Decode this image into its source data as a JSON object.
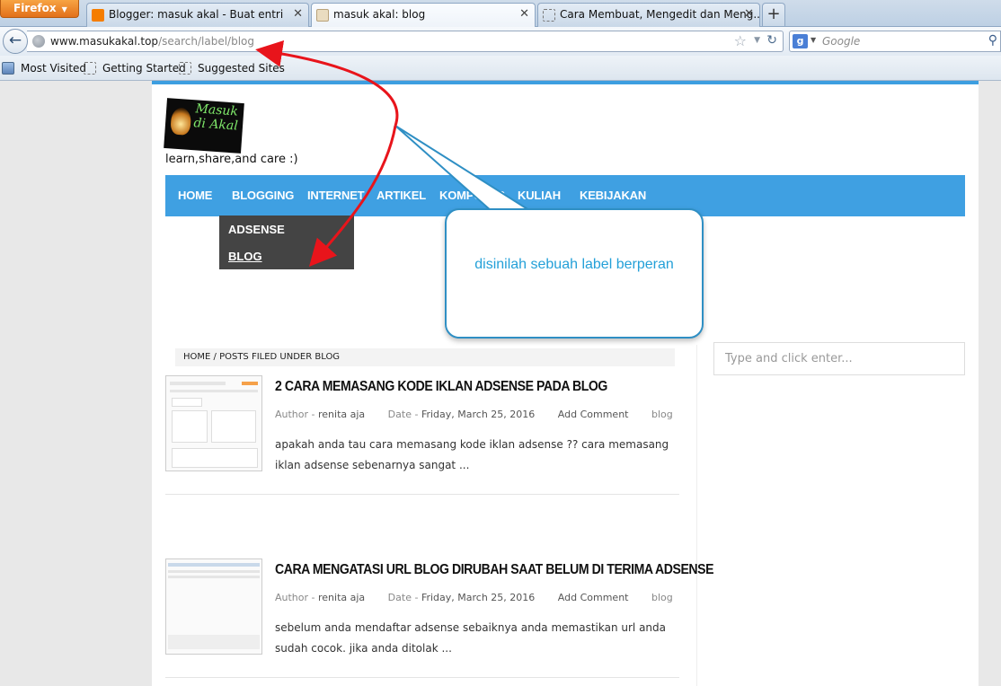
{
  "browser": {
    "firefox_button": "Firefox",
    "tabs": [
      {
        "title": "Blogger: masuk akal - Buat entri",
        "icon": "blogger-icon"
      },
      {
        "title": "masuk akal: blog",
        "icon": "page-icon"
      },
      {
        "title": "Cara Membuat, Mengedit dan Meng...",
        "icon": "blank-page-icon"
      }
    ],
    "url_domain": "www.masukakal.top",
    "url_path": "/search/label/blog",
    "search_placeholder": "Google",
    "bookmarks": [
      "Most Visited",
      "Getting Started",
      "Suggested Sites"
    ]
  },
  "site": {
    "logo_text": "Masuk di Akal",
    "tagline": "learn,share,and care :)",
    "nav": [
      "HOME",
      "BLOGGING",
      "INTERNET",
      "ARTIKEL",
      "KOMPUTER",
      "KULIAH",
      "KEBIJAKAN"
    ],
    "dropdown": [
      "ADSENSE",
      "BLOG"
    ],
    "breadcrumb": "HOME / POSTS FILED UNDER BLOG",
    "search_placeholder": "Type and click enter...",
    "posts": [
      {
        "title": "2 CARA MEMASANG KODE IKLAN ADSENSE PADA BLOG",
        "author_label": "Author -",
        "author": "renita aja",
        "date_label": "Date -",
        "date": "Friday, March 25, 2016",
        "comment": "Add Comment",
        "label": "blog",
        "excerpt": "apakah anda tau cara memasang kode iklan adsense ?? cara memasang iklan adsense sebenarnya sangat ..."
      },
      {
        "title": "CARA MENGATASI URL BLOG DIRUBAH SAAT BELUM DI TERIMA ADSENSE",
        "author_label": "Author -",
        "author": "renita aja",
        "date_label": "Date -",
        "date": "Friday, March 25, 2016",
        "comment": "Add Comment",
        "label": "blog",
        "excerpt": "sebelum anda mendaftar adsense sebaiknya anda memastikan url anda sudah cocok. jika anda ditolak ..."
      }
    ]
  },
  "annotation": {
    "callout_text": "disinilah sebuah label berperan",
    "arrow_color": "#e8141b"
  },
  "colors": {
    "nav_blue": "#3fa0e2",
    "dropdown_bg": "#444444",
    "callout_border": "#2f8fc4",
    "callout_text": "#24a0d8"
  }
}
